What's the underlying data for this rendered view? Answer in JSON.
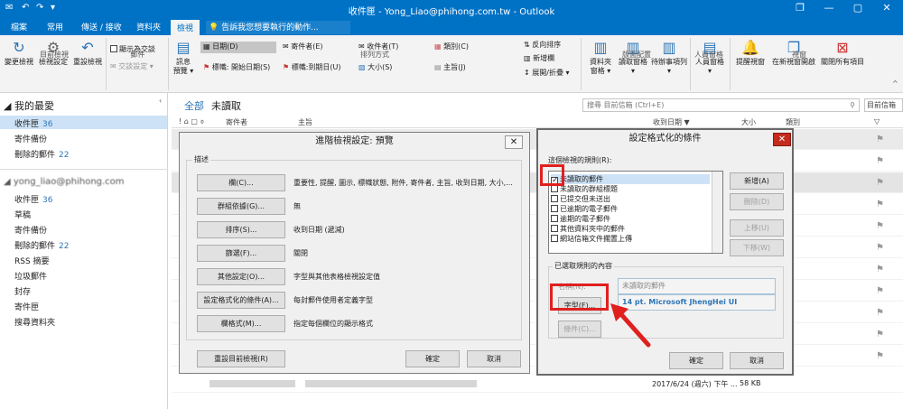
{
  "window": {
    "title": "收件匣 - Yong_Liao@phihong.com.tw - Outlook",
    "undo": "↶",
    "redo": "↷",
    "qa_arrow": "▾",
    "min": "—",
    "max": "▢",
    "close": "✕",
    "help": "?",
    "restore": "❐"
  },
  "tabs": [
    "檔案",
    "常用",
    "傳送 / 接收",
    "資料夾",
    "檢視"
  ],
  "active_tab": "檢視",
  "tellme": "告訴我您想要執行的動作...",
  "ribbon": {
    "change_view": "變更檢視",
    "view_settings": "檢視設定",
    "reset_view": "重設檢視",
    "group_current": "目前檢視",
    "show_as_conv": "顯示為交談",
    "conv_settings": "交談設定 ▾",
    "group_msg": "郵件",
    "msg_preview": "訊息\n預覽 ▾",
    "arrange": [
      "日期(D)",
      "寄件者(E)",
      "收件者(T)",
      "類別(C)",
      "標幟: 開始日期(S)",
      "標幟:到期日(U)",
      "大小(S)",
      "主旨(J)"
    ],
    "reverse": "反向排序",
    "add_col": "新增欄",
    "expand": "展開/折疊 ▾",
    "group_arrange": "排列方式",
    "folder_pane": "資料夾\n窗格 ▾",
    "reading_pane": "讀取窗格\n▾",
    "todo_bar": "待辦事項列\n▾",
    "group_layout": "版面配置",
    "people_pane": "人員窗格\n▾",
    "group_people": "人員窗格",
    "reminders": "提醒視窗",
    "open_new": "在新視窗開啟",
    "close_all": "關閉所有項目",
    "group_window": "視窗"
  },
  "sidebar": {
    "fav_header": "我的最愛",
    "fav": [
      {
        "label": "收件匣",
        "count": "36"
      },
      {
        "label": "寄件備份",
        "count": ""
      },
      {
        "label": "刪除的郵件",
        "count": "22"
      }
    ],
    "account": "yong_liao@phihong.com",
    "folders": [
      {
        "label": "收件匣",
        "count": "36"
      },
      {
        "label": "草稿",
        "count": ""
      },
      {
        "label": "寄件備份",
        "count": ""
      },
      {
        "label": "刪除的郵件",
        "count": "22"
      },
      {
        "label": "RSS 摘要",
        "count": ""
      },
      {
        "label": "垃圾郵件",
        "count": ""
      },
      {
        "label": "封存",
        "count": ""
      },
      {
        "label": "寄件匣",
        "count": ""
      },
      {
        "label": "搜尋資料夾",
        "count": ""
      }
    ]
  },
  "list": {
    "filter_all": "全部",
    "filter_unread": "未讀取",
    "search_placeholder": "搜尋 目前信箱 (Ctrl+E)",
    "search_icon": "⚲",
    "scope": "目前信箱",
    "col_from": "寄件者",
    "col_subject": "主旨",
    "col_received": "收到日期",
    "col_size": "大小",
    "col_category": "類別",
    "last_date": "2017/6/24 (週六) 下午 ...",
    "last_size": "58 KB"
  },
  "adv_dialog": {
    "title": "進階檢視設定: 預覽",
    "group": "描述",
    "rows": [
      {
        "btn": "欄(C)...",
        "desc": "重要性, 提醒, 圖示, 標幟狀態, 附件, 寄件者, 主旨, 收到日期, 大小,..."
      },
      {
        "btn": "群組依據(G)...",
        "desc": "無"
      },
      {
        "btn": "排序(S)...",
        "desc": "收到日期 (遞減)"
      },
      {
        "btn": "篩選(F)...",
        "desc": "關閉"
      },
      {
        "btn": "其他設定(O)...",
        "desc": "字型與其他表格檢視設定值"
      },
      {
        "btn": "設定格式化的條件(A)...",
        "desc": "每封郵件使用者定義字型"
      },
      {
        "btn": "欄格式(M)...",
        "desc": "指定每個欄位的顯示格式"
      }
    ],
    "reset": "重設目前檢視(R)",
    "ok": "確定",
    "cancel": "取消"
  },
  "cond_dialog": {
    "title": "設定格式化的條件",
    "rules_label": "這個檢視的規則(R):",
    "rules": [
      {
        "label": "未讀取的郵件",
        "checked": true
      },
      {
        "label": "未讀取的群組標題",
        "checked": false
      },
      {
        "label": "已提交但未送出",
        "checked": false
      },
      {
        "label": "已逾期的電子郵件",
        "checked": false
      },
      {
        "label": "逾期的電子郵件",
        "checked": false
      },
      {
        "label": "其他資料夾中的郵件",
        "checked": false
      },
      {
        "label": "網站信箱文件擱置上傳",
        "checked": false
      }
    ],
    "add": "新增(A)",
    "delete": "刪除(D)",
    "up": "上移(U)",
    "down": "下移(W)",
    "props_label": "已選取規則的內容",
    "name_label": "名稱(N):",
    "name_value": "未讀取的郵件",
    "font_btn": "字型(F)...",
    "font_value": "14 pt. Microsoft JhengHei UI",
    "cond_btn": "條件(C)...",
    "ok": "確定",
    "cancel": "取消"
  },
  "colors": {
    "accent": "#0072c6",
    "highlight": "#e0201f",
    "link": "#2e75b6"
  }
}
